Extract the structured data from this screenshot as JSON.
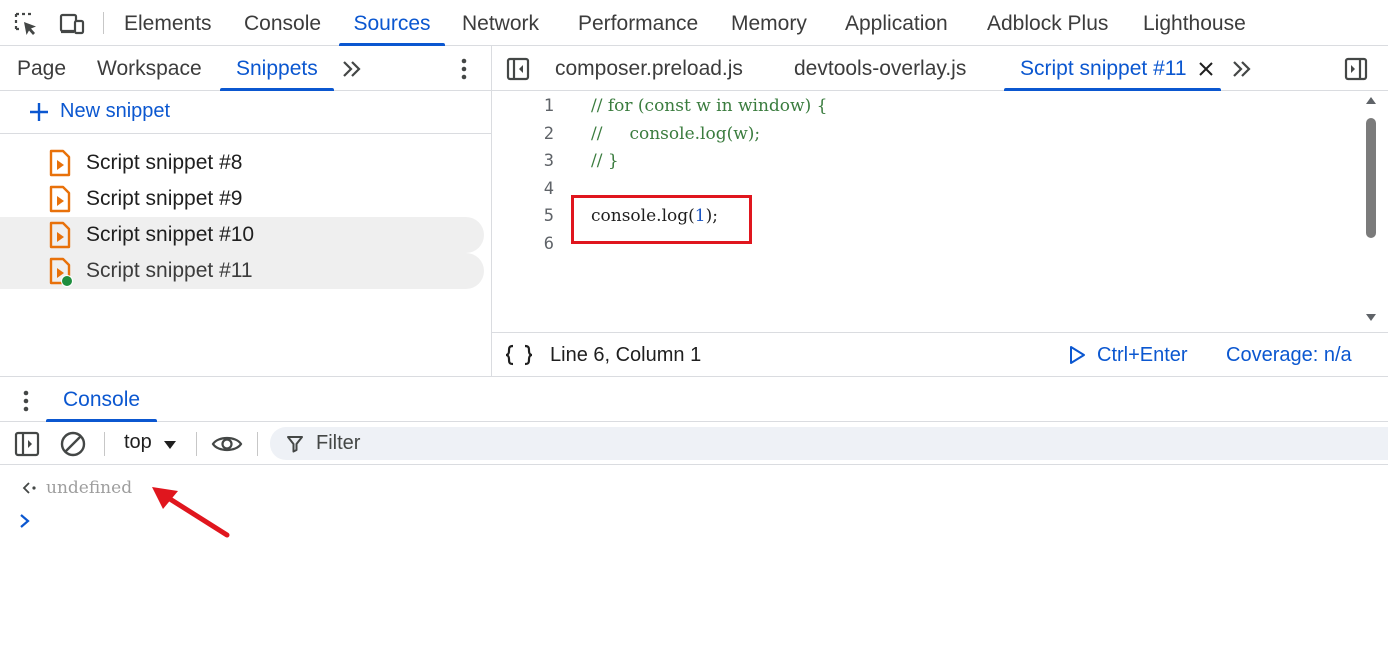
{
  "main_tabs": [
    "Elements",
    "Console",
    "Sources",
    "Network",
    "Performance",
    "Memory",
    "Application",
    "Adblock Plus",
    "Lighthouse"
  ],
  "active_main_tab": "Sources",
  "navigator": {
    "tabs": [
      "Page",
      "Workspace",
      "Snippets"
    ],
    "active_tab": "Snippets",
    "new_snippet_label": "New snippet",
    "snippets": [
      "Script snippet #8",
      "Script snippet #9",
      "Script snippet #10",
      "Script snippet #11"
    ]
  },
  "editor": {
    "tabs": [
      "composer.preload.js",
      "devtools-overlay.js",
      "Script snippet #11"
    ],
    "active_tab": "Script snippet #11",
    "lines": [
      {
        "num": "1",
        "tokens": [
          {
            "t": "// for (const w in window) {",
            "k": "comment"
          }
        ]
      },
      {
        "num": "2",
        "tokens": [
          {
            "t": "//     console.log(w);",
            "k": "comment"
          }
        ]
      },
      {
        "num": "3",
        "tokens": [
          {
            "t": "// }",
            "k": "comment"
          }
        ]
      },
      {
        "num": "4",
        "tokens": []
      },
      {
        "num": "5",
        "tokens": [
          {
            "t": "console.log(",
            "k": "plain"
          },
          {
            "t": "1",
            "k": "num"
          },
          {
            "t": ");",
            "k": "plain"
          }
        ]
      },
      {
        "num": "6",
        "tokens": []
      }
    ],
    "status": {
      "position": "Line 6, Column 1",
      "run_shortcut": "Ctrl+Enter",
      "coverage": "Coverage: n/a"
    }
  },
  "drawer": {
    "tab": "Console",
    "context": "top",
    "filter_label": "Filter",
    "output": [
      "undefined"
    ]
  },
  "colors": {
    "accent": "#0b57d0",
    "snippet_icon": "#e8710a",
    "run_indicator": "#1e8e3e",
    "annotation": "#e0161e"
  }
}
